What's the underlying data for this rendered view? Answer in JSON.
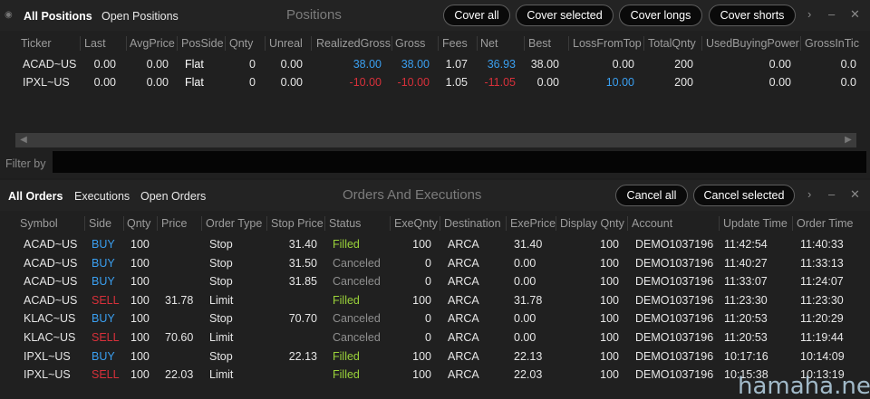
{
  "positions": {
    "tabs": [
      "All Positions",
      "Open Positions"
    ],
    "title": "Positions",
    "buttons": [
      "Cover all",
      "Cover selected",
      "Cover longs",
      "Cover shorts"
    ],
    "controls": {
      "next": "›",
      "minimize": "–",
      "close": "✕"
    },
    "columns": [
      "Ticker",
      "Last",
      "AvgPrice",
      "PosSide",
      "Qnty",
      "Unreal",
      "RealizedGross",
      "Gross",
      "Fees",
      "Net",
      "Best",
      "LossFromTop",
      "TotalQnty",
      "UsedBuyingPower",
      "GrossInTic"
    ],
    "rows": [
      [
        "ACAD~US",
        "0.00",
        "0.00",
        "Flat",
        "0",
        "0.00",
        "38.00",
        "38.00",
        "1.07",
        "36.93",
        "38.00",
        "0.00",
        "200",
        "0.00",
        "0.0"
      ],
      [
        "IPXL~US",
        "0.00",
        "0.00",
        "Flat",
        "0",
        "0.00",
        "-10.00",
        "-10.00",
        "1.05",
        "-11.05",
        "0.00",
        "10.00",
        "200",
        "0.00",
        "0.0"
      ]
    ],
    "filter_label": "Filter by",
    "filter_value": ""
  },
  "orders": {
    "tabs": [
      "All Orders",
      "Executions",
      "Open Orders"
    ],
    "title": "Orders And Executions",
    "buttons": [
      "Cancel all",
      "Cancel selected"
    ],
    "controls": {
      "next": "›",
      "minimize": "–",
      "close": "✕"
    },
    "columns": [
      "Symbol",
      "Side",
      "Qnty",
      "Price",
      "Order Type",
      "Stop Price",
      "Status",
      "ExeQnty",
      "Destination",
      "ExePrice",
      "Display Qnty",
      "Account",
      "Update Time",
      "Order Time"
    ],
    "rows": [
      [
        "ACAD~US",
        "BUY",
        "100",
        "",
        "Stop",
        "31.40",
        "Filled",
        "100",
        "ARCA",
        "31.40",
        "100",
        "DEMO1037196",
        "11:42:54",
        "11:40:33"
      ],
      [
        "ACAD~US",
        "BUY",
        "100",
        "",
        "Stop",
        "31.50",
        "Canceled",
        "0",
        "ARCA",
        "0.00",
        "100",
        "DEMO1037196",
        "11:40:27",
        "11:33:13"
      ],
      [
        "ACAD~US",
        "BUY",
        "100",
        "",
        "Stop",
        "31.85",
        "Canceled",
        "0",
        "ARCA",
        "0.00",
        "100",
        "DEMO1037196",
        "11:33:07",
        "11:24:07"
      ],
      [
        "ACAD~US",
        "SELL",
        "100",
        "31.78",
        "Limit",
        "",
        "Filled",
        "100",
        "ARCA",
        "31.78",
        "100",
        "DEMO1037196",
        "11:23:30",
        "11:23:30"
      ],
      [
        "KLAC~US",
        "BUY",
        "100",
        "",
        "Stop",
        "70.70",
        "Canceled",
        "0",
        "ARCA",
        "0.00",
        "100",
        "DEMO1037196",
        "11:20:53",
        "11:20:29"
      ],
      [
        "KLAC~US",
        "SELL",
        "100",
        "70.60",
        "Limit",
        "",
        "Canceled",
        "0",
        "ARCA",
        "0.00",
        "100",
        "DEMO1037196",
        "11:20:53",
        "11:19:44"
      ],
      [
        "IPXL~US",
        "BUY",
        "100",
        "",
        "Stop",
        "22.13",
        "Filled",
        "100",
        "ARCA",
        "22.13",
        "100",
        "DEMO1037196",
        "10:17:16",
        "10:14:09"
      ],
      [
        "IPXL~US",
        "SELL",
        "100",
        "22.03",
        "Limit",
        "",
        "Filled",
        "100",
        "ARCA",
        "22.03",
        "100",
        "DEMO1037196",
        "10:15:38",
        "10:13:19"
      ]
    ]
  },
  "watermark": "hamaha.net",
  "colors": {
    "buy": "#3a9ff0",
    "sell": "#d8303a",
    "filled": "#9ad23a",
    "canceled": "#8f8f8f",
    "positive": "#3a9ff0",
    "negative": "#d8303a"
  }
}
